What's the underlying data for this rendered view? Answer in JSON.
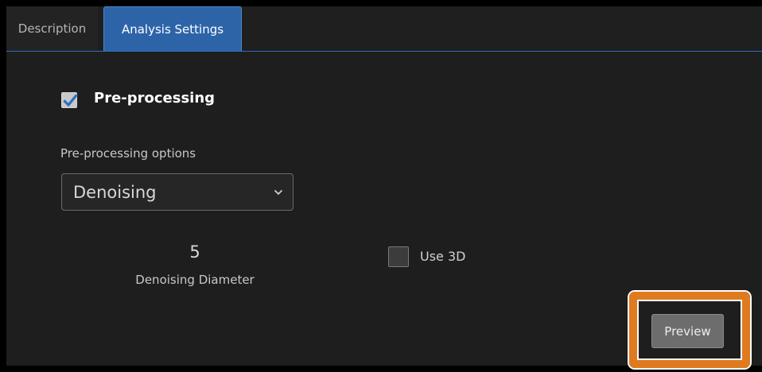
{
  "tabs": [
    {
      "label": "Description",
      "active": false
    },
    {
      "label": "Analysis Settings",
      "active": true
    }
  ],
  "preprocessing": {
    "checkbox_label": "Pre-processing",
    "checked": true,
    "options_label": "Pre-processing options",
    "selected_option": "Denoising"
  },
  "denoising": {
    "diameter_value": "5",
    "diameter_label": "Denoising Diameter"
  },
  "use3d": {
    "label": "Use 3D",
    "checked": false
  },
  "actions": {
    "preview_label": "Preview"
  },
  "colors": {
    "accent": "#2d64a8",
    "highlight": "#e07a1f",
    "checkmark": "#2e6fc0",
    "background": "#1e1e1e"
  },
  "icons": {
    "checkbox_checked": "checkmark-icon",
    "dropdown": "chevron-down-icon"
  }
}
